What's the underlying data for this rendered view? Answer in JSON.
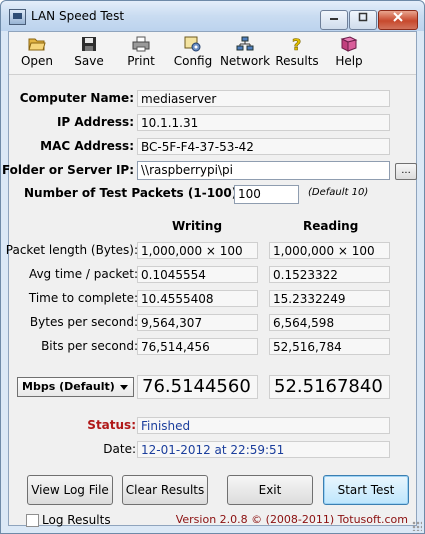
{
  "window": {
    "title": "LAN Speed Test"
  },
  "toolbar": {
    "items": [
      {
        "label": "Open",
        "icon": "folder-open-icon"
      },
      {
        "label": "Save",
        "icon": "floppy-disk-icon"
      },
      {
        "label": "Print",
        "icon": "printer-icon"
      },
      {
        "label": "Config",
        "icon": "config-icon"
      },
      {
        "label": "Network",
        "icon": "network-icon"
      },
      {
        "label": "Results",
        "icon": "question-icon"
      },
      {
        "label": "Help",
        "icon": "help-book-icon"
      }
    ]
  },
  "info": {
    "computer_name_label": "Computer Name:",
    "computer_name": "mediaserver",
    "ip_label": "IP Address:",
    "ip": "10.1.1.31",
    "mac_label": "MAC Address:",
    "mac": "BC-5F-F4-37-53-42",
    "folder_label": "Folder or Server IP:",
    "folder": "\\\\raspberrypi\\pi",
    "browse_label": "...",
    "packets_label": "Number of Test Packets (1-100):",
    "packets": "100",
    "packets_default": "(Default 10)"
  },
  "results": {
    "writing_header": "Writing",
    "reading_header": "Reading",
    "rows": [
      {
        "label": "Packet length (Bytes):",
        "writing": "1,000,000  ×  100",
        "reading": "1,000,000  ×  100"
      },
      {
        "label": "Avg time / packet:",
        "writing": "0.1045554",
        "reading": "0.1523322"
      },
      {
        "label": "Time to complete:",
        "writing": "10.4555408",
        "reading": "15.2332249"
      },
      {
        "label": "Bytes per second:",
        "writing": "9,564,307",
        "reading": "6,564,598"
      },
      {
        "label": "Bits per second:",
        "writing": "76,514,456",
        "reading": "52,516,784"
      }
    ],
    "unit_select": "Mbps (Default)",
    "writing_speed": "76.5144560",
    "reading_speed": "52.5167840"
  },
  "status": {
    "status_label": "Status:",
    "status_value": "Finished",
    "date_label": "Date:",
    "date_value": "12-01-2012 at 22:59:51"
  },
  "buttons": {
    "view_log": "View Log File",
    "clear_results": "Clear Results",
    "exit": "Exit",
    "start_test": "Start Test"
  },
  "footer": {
    "log_results": "Log Results",
    "version": "Version 2.0.8  © (2008-2011) Totusoft.com"
  },
  "colors": {
    "status_label": "#b01818",
    "value_blue": "#1b3e9c",
    "version": "#8b1010"
  }
}
